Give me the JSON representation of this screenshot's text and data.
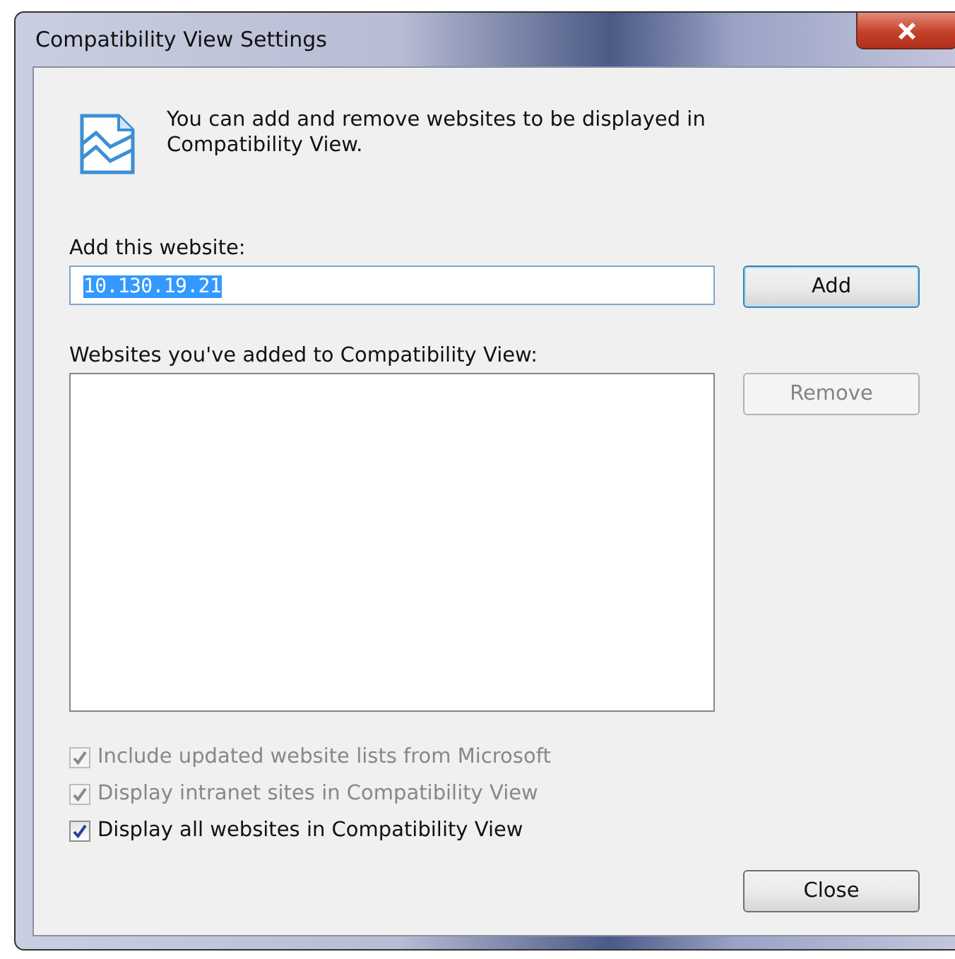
{
  "window": {
    "title": "Compatibility View Settings"
  },
  "intro": "You can add and remove websites to be displayed in Compatibility View.",
  "add_field": {
    "label": "Add this website:",
    "value": "10.130.19.21"
  },
  "add_button": {
    "label": "Add",
    "disabled": false
  },
  "list": {
    "label": "Websites you've added to Compatibility View:"
  },
  "remove_button": {
    "label": "Remove",
    "disabled": true
  },
  "options": [
    {
      "label": "Include updated website lists from Microsoft",
      "checked": true,
      "disabled": true
    },
    {
      "label": "Display intranet sites in Compatibility View",
      "checked": true,
      "disabled": true
    },
    {
      "label": "Display all websites in Compatibility View",
      "checked": true,
      "disabled": false
    }
  ],
  "close_button": {
    "label": "Close",
    "disabled": false
  }
}
